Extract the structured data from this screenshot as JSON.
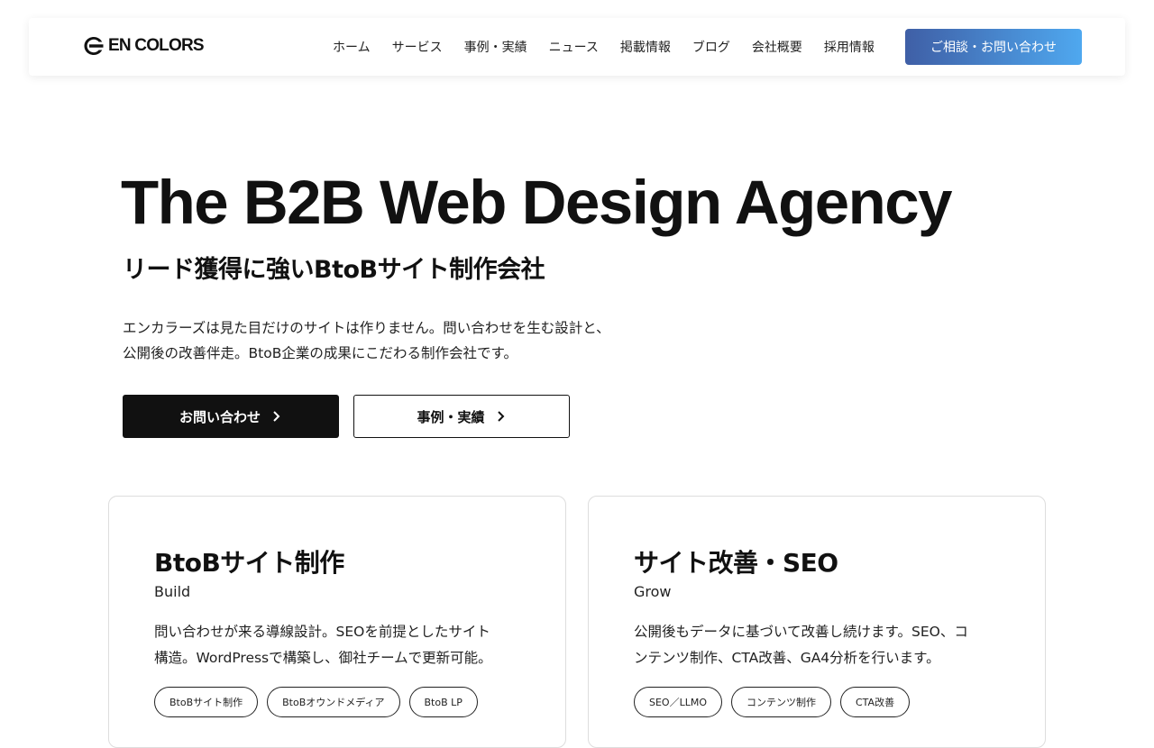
{
  "header": {
    "logo_text": "EN COLORS",
    "nav": [
      "ホーム",
      "サービス",
      "事例・実績",
      "ニュース",
      "掲載情報",
      "ブログ",
      "会社概要",
      "採用情報"
    ],
    "cta_label": "ご相談・お問い合わせ"
  },
  "hero": {
    "title": "The B2B Web Design Agency",
    "subtitle": "リード獲得に強いBtoBサイト制作会社",
    "description": [
      "エンカラーズは見た目だけのサイトは作りません。問い合わせを生む設計と、",
      "公開後の改善伴走。BtoB企業の成果にこだわる制作会社です。"
    ],
    "primary_button": "お問い合わせ",
    "secondary_button": "事例・実績"
  },
  "cards": [
    {
      "title": "BtoBサイト制作",
      "subtitle": "Build",
      "description": [
        "問い合わせが来る導線設計。SEOを前提としたサイト",
        "構造。WordPressで構築し、御社チームで更新可能。"
      ],
      "tags": [
        "BtoBサイト制作",
        "BtoBオウンドメディア",
        "BtoB LP"
      ]
    },
    {
      "title": "サイト改善・SEO",
      "subtitle": "Grow",
      "description": [
        "公開後もデータに基づいて改善し続けます。SEO、コ",
        "ンテンツ制作、CTA改善、GA4分析を行います。"
      ],
      "tags": [
        "SEO／LLMO",
        "コンテンツ制作",
        "CTA改善"
      ]
    }
  ],
  "colors": {
    "cta_gradient_start": "#3f5fa6",
    "cta_gradient_end": "#4fa8ef",
    "primary_button_bg": "#111111"
  }
}
